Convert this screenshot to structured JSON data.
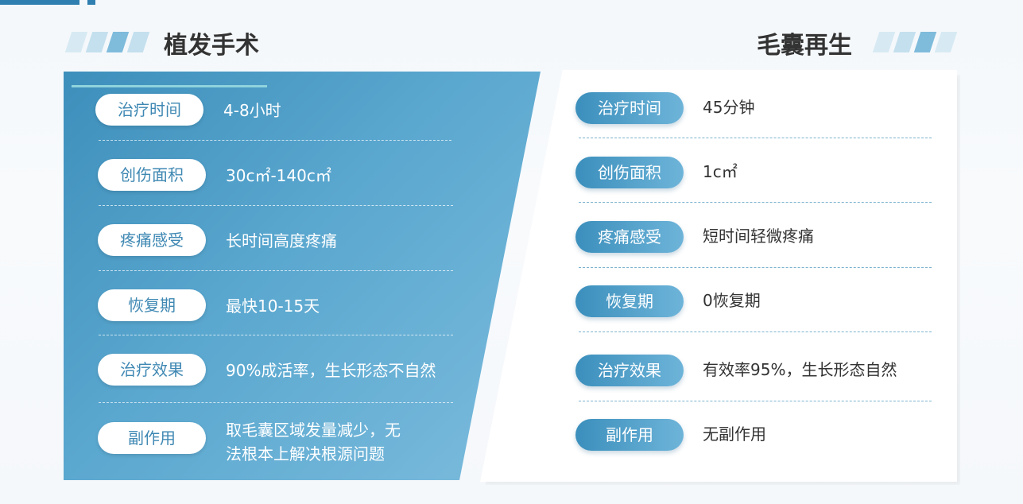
{
  "colors": {
    "accent": "#3d8fbb",
    "accent_light": "#7cbcdd",
    "text_dark": "#333333"
  },
  "left": {
    "title": "植发手术",
    "rows": [
      {
        "label": "治疗时间",
        "value": "4-8小时"
      },
      {
        "label": "创伤面积",
        "value": "30c㎡-140c㎡"
      },
      {
        "label": "疼痛感受",
        "value": "长时间高度疼痛"
      },
      {
        "label": "恢复期",
        "value": "最快10-15天"
      },
      {
        "label": "治疗效果",
        "value": "90%成活率，生长形态不自然"
      },
      {
        "label": "副作用",
        "value": "取毛囊区域发量减少，无法根本上解决根源问题",
        "line1": "取毛囊区域发量减少，无",
        "line2": "法根本上解决根源问题"
      }
    ]
  },
  "right": {
    "title": "毛囊再生",
    "rows": [
      {
        "label": "治疗时间",
        "value": "45分钟"
      },
      {
        "label": "创伤面积",
        "value": "1c㎡"
      },
      {
        "label": "疼痛感受",
        "value": "短时间轻微疼痛"
      },
      {
        "label": "恢复期",
        "value": "0恢复期"
      },
      {
        "label": "治疗效果",
        "value": "有效率95%，生长形态自然"
      },
      {
        "label": "副作用",
        "value": "无副作用"
      }
    ]
  }
}
